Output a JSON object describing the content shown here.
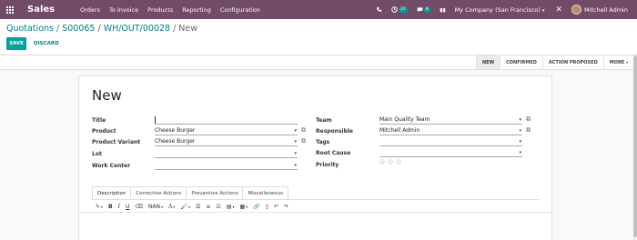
{
  "navbar": {
    "brand": "Sales",
    "menu": [
      "Orders",
      "To Invoice",
      "Products",
      "Reporting",
      "Configuration"
    ],
    "activity_badge": "37",
    "chat_badge": "9",
    "company": "My Company (San Francisco)",
    "user": "Mitchell Admin",
    "colors": {
      "primary": "#714b67",
      "badge": "#00a09d"
    }
  },
  "breadcrumb": {
    "items": [
      "Quotations",
      "S00065",
      "WH/OUT/00028"
    ],
    "current": "New"
  },
  "buttons": {
    "save": "SAVE",
    "discard": "DISCARD"
  },
  "stages": [
    "NEW",
    "CONFIRMED",
    "ACTION PROPOSED",
    "MORE"
  ],
  "form": {
    "title": "New",
    "left": {
      "title_label": "Title",
      "title_value": "",
      "product_label": "Product",
      "product_value": "Cheese Burger",
      "variant_label": "Product Variant",
      "variant_value": "Cheese Burger",
      "lot_label": "Lot",
      "lot_value": "",
      "workcenter_label": "Work Center",
      "workcenter_value": ""
    },
    "right": {
      "team_label": "Team",
      "team_value": "Main Quality Team",
      "responsible_label": "Responsible",
      "responsible_value": "Mitchell Admin",
      "tags_label": "Tags",
      "tags_value": "",
      "rootcause_label": "Root Cause",
      "rootcause_value": "",
      "priority_label": "Priority",
      "priority_stars": 0
    }
  },
  "tabs": [
    "Description",
    "Corrective Actions",
    "Preventive Actions",
    "Miscellaneous"
  ],
  "editor_toolbar": {
    "font_size": "NAN"
  }
}
